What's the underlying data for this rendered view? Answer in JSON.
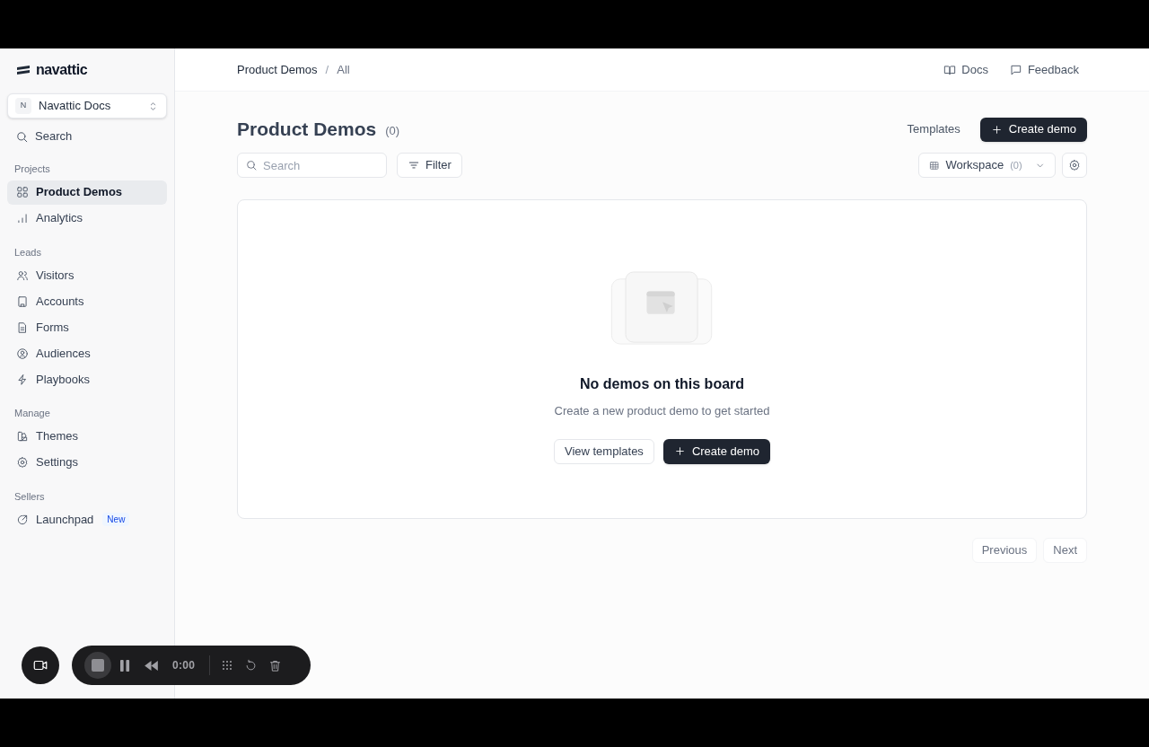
{
  "sidebar": {
    "logo": "navattic",
    "workspace": {
      "initial": "N",
      "name": "Navattic Docs"
    },
    "search": "Search",
    "sections": [
      {
        "title": "Projects",
        "items": [
          {
            "label": "Product Demos",
            "selected": true
          },
          {
            "label": "Analytics",
            "selected": false
          }
        ]
      },
      {
        "title": "Leads",
        "items": [
          {
            "label": "Visitors",
            "selected": false
          },
          {
            "label": "Accounts",
            "selected": false
          },
          {
            "label": "Forms",
            "selected": false
          },
          {
            "label": "Audiences",
            "selected": false
          },
          {
            "label": "Playbooks",
            "selected": false
          }
        ]
      },
      {
        "title": "Manage",
        "items": [
          {
            "label": "Themes",
            "selected": false
          },
          {
            "label": "Settings",
            "selected": false
          }
        ]
      },
      {
        "title": "Sellers",
        "items": [
          {
            "label": "Launchpad",
            "selected": false,
            "badge": "New"
          }
        ]
      }
    ]
  },
  "header": {
    "breadcrumbs": [
      "Product Demos",
      "All"
    ],
    "breadcrumb_separator": "/",
    "links": [
      "Docs",
      "Feedback"
    ]
  },
  "page": {
    "title": "Product Demos",
    "count": "(0)",
    "templates_button": "Templates",
    "create_button": "Create demo",
    "search_placeholder": "Search",
    "filter_button": "Filter",
    "workspace_select": {
      "label": "Workspace",
      "count": "(0)"
    }
  },
  "empty_state": {
    "title": "No demos on this board",
    "subtitle": "Create a new product demo to get started",
    "buttons": [
      {
        "label": "View templates",
        "kind": "secondary"
      },
      {
        "label": "Create demo",
        "kind": "primary"
      }
    ]
  },
  "pagination": [
    {
      "label": "Previous",
      "disabled": true
    },
    {
      "label": "Next",
      "disabled": true
    }
  ],
  "recorder": {
    "time": "0:00"
  }
}
